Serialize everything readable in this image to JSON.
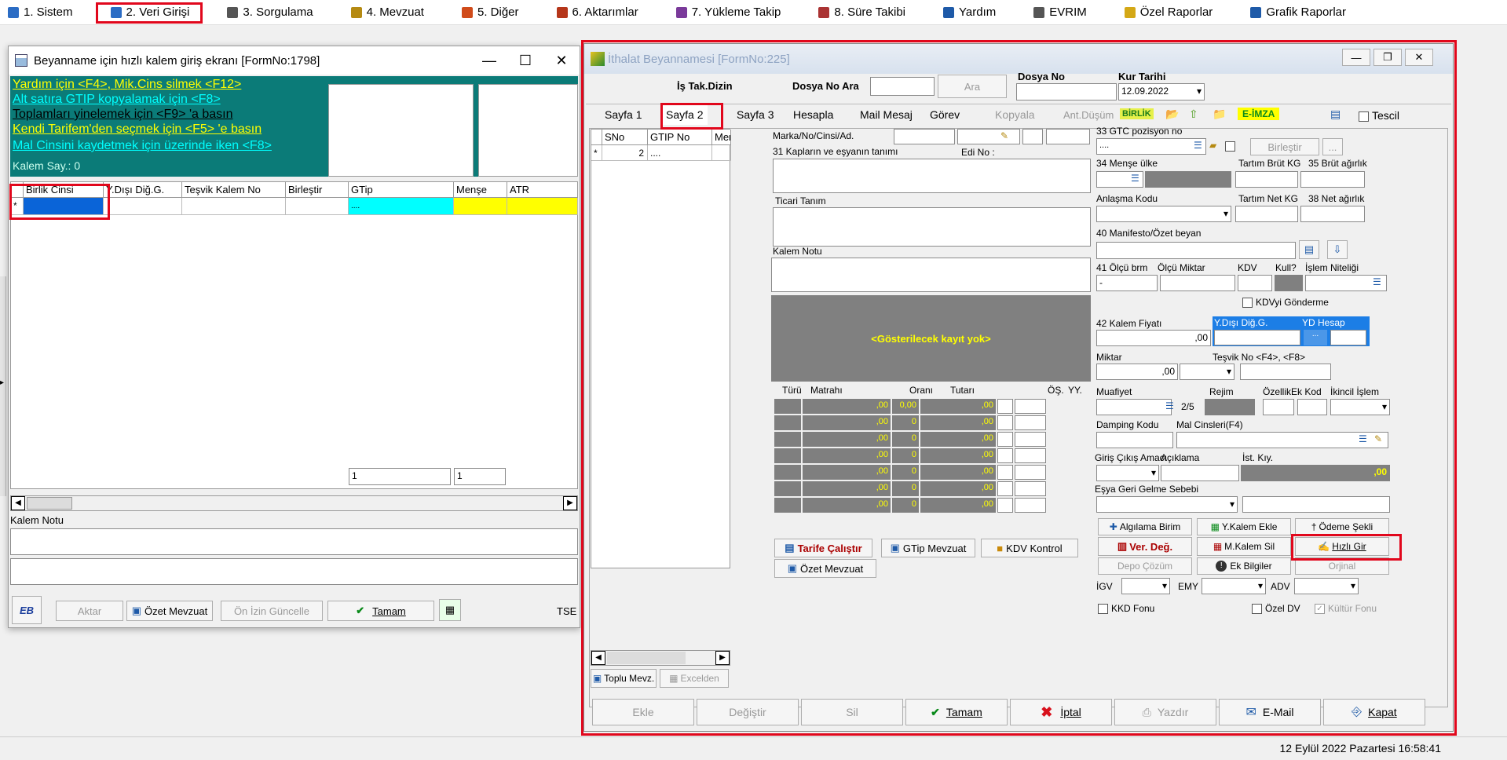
{
  "menu": [
    {
      "num": "1.",
      "label": "Sistem",
      "icon": "system-icon"
    },
    {
      "num": "2.",
      "label": "Veri Girişi",
      "icon": "data-entry-icon"
    },
    {
      "num": "3.",
      "label": "Sorgulama",
      "icon": "query-icon"
    },
    {
      "num": "4.",
      "label": "Mevzuat",
      "icon": "books-icon"
    },
    {
      "num": "5.",
      "label": "Diğer",
      "icon": "other-icon"
    },
    {
      "num": "6.",
      "label": "Aktarımlar",
      "icon": "transfer-icon"
    },
    {
      "num": "7.",
      "label": "Yükleme Takip",
      "icon": "tracking-icon"
    },
    {
      "num": "8.",
      "label": "Süre Takibi",
      "icon": "calendar-icon"
    },
    {
      "num": "",
      "label": "Yardım",
      "icon": "help-icon"
    },
    {
      "num": "",
      "label": "EVRIM",
      "icon": "evrim-icon"
    },
    {
      "num": "",
      "label": "Özel Raporlar",
      "icon": "star-icon"
    },
    {
      "num": "",
      "label": "Grafik Raporlar",
      "icon": "chart-icon"
    }
  ],
  "status": {
    "datetime": "12 Eylül 2022 Pazartesi 16:58:41"
  },
  "quick": {
    "title": "Beyanname için hızlı kalem giriş ekranı [FormNo:1798]",
    "help": [
      {
        "text": "Yardım için <F4>, Mik.Cins silmek <F12>",
        "color": "#ffff00"
      },
      {
        "text": "Alt satıra GTIP kopyalamak için <F8>",
        "color": "#00ffff"
      },
      {
        "text": "Toplamları yinelemek için <F9> 'a basın",
        "color": "#000000"
      },
      {
        "text": "Kendi Tarifem'den seçmek  için <F5> 'e basın",
        "color": "#ffff00"
      },
      {
        "text": "Mal Cinsini kaydetmek için üzerinde iken <F8>",
        "color": "#00ffff"
      }
    ],
    "kalem_say": "Kalem Say.: 0",
    "columns": [
      "Birlik Cinsi",
      "Y.Dışı Diğ.G.",
      "Teşvik Kalem No",
      "Birleştir",
      "GTip",
      "Menşe",
      "ATR"
    ],
    "row_marker": "*",
    "gtip_value": "....",
    "footer_nums": [
      "1",
      "1"
    ],
    "kalem_notu_label": "Kalem Notu",
    "buttons": {
      "aktar": "Aktar",
      "ozet": "Özet Mevzuat",
      "on_izin": "Ön İzin Güncelle",
      "tamam": "Tamam"
    },
    "tse": "TSE"
  },
  "ithal": {
    "title": "İthalat Beyannamesi [FormNo:225]",
    "is_tak": "İş Tak.Dizin",
    "dosya_no_ara": "Dosya No Ara",
    "ara_btn": "Ara",
    "dosya_no": "Dosya No",
    "kur_tarihi": "Kur Tarihi",
    "kur_value": "12.09.2022",
    "tabs": [
      "Sayfa 1",
      "Sayfa 2",
      "Sayfa 3",
      "Hesapla",
      "Mail Mesaj",
      "Görev",
      "Kopyala",
      "Ant.Düşüm"
    ],
    "birlik": "BİRLİK",
    "eimza": "E-İMZA",
    "tescil": "Tescil",
    "list_cols": [
      "SNo",
      "GTIP No",
      "Menşe"
    ],
    "list_row": {
      "marker": "*",
      "sno": "2",
      "gtip": "...."
    },
    "marka": "Marka/No/Cinsi/Ad.",
    "kaplar": "31 Kapların ve eşyanın tanımı",
    "edi": "Edi No :",
    "ticari": "Ticari Tanım",
    "kalem_notu": "Kalem Notu",
    "no_records": "<Gösterilecek kayıt yok>",
    "tax_cols": [
      "Türü",
      "Matrahı",
      "Oranı",
      "Tutarı",
      "ÖŞ.",
      "YY."
    ],
    "tax_rows": [
      [
        ",00",
        "0,00",
        ",00"
      ],
      [
        ",00",
        "0",
        ",00"
      ],
      [
        ",00",
        "0",
        ",00"
      ],
      [
        ",00",
        "0",
        ",00"
      ],
      [
        ",00",
        "0",
        ",00"
      ],
      [
        ",00",
        "0",
        ",00"
      ],
      [
        ",00",
        "0",
        ",00"
      ]
    ],
    "tarife": "Tarife Çalıştır",
    "gtip_mevzuat": "GTip Mevzuat",
    "kdv_kontrol": "KDV Kontrol",
    "ozet_mevzuat": "Özet Mevzuat",
    "toplu": "Toplu Mevz.",
    "excelden": "Excelden",
    "gtc": "33 GTC pozisyon no",
    "gtc_value": "....",
    "birlestir": "Birleştir",
    "mense_ulke": "34 Menşe ülke",
    "tartim_brut": "Tartım Brüt KG",
    "brut": "35 Brüt ağırlık",
    "anlasma": "Anlaşma Kodu",
    "tartim_net": "Tartım Net KG",
    "net": "38 Net ağırlık",
    "manifesto": "40 Manifesto/Özet beyan",
    "olcu_brm": "41 Ölçü brm",
    "olcu_miktar": "Ölçü Miktar",
    "kdv": "KDV",
    "kull": "Kull?",
    "islem": "İşlem Niteliği",
    "olcu_value": "-",
    "kdv_gonderme": "KDVyi Gönderme",
    "kalem_fiyati": "42 Kalem Fiyatı",
    "kalem_fiyati_value": ",00",
    "ydisi": "Y.Dışı Diğ.G.",
    "yd_hesap": "YD Hesap",
    "miktar": "Miktar",
    "miktar_value": ",00",
    "tesvik": "Teşvik No <F4>, <F8>",
    "muafiyet": "Muafiyet",
    "muafiyet_value": "2/5",
    "rejim": "Rejim",
    "ozellik": "ÖzellikEk Kod",
    "ikincil": "İkincil İşlem",
    "damping": "Damping Kodu",
    "mal_cinsleri": "Mal Cinsleri(F4)",
    "giris_cikis": "Giriş Çıkış Amacı",
    "aciklama": "Açıklama",
    "ist_kiy": "İst. Kıy.",
    "ist_value": ",00",
    "esya_geri": "Eşya Geri Gelme Sebebi",
    "algilama": "Algılama Birim",
    "y_kalem": "Y.Kalem Ekle",
    "odeme": "Ödeme Şekli",
    "ver_deg": "Ver. Değ.",
    "m_kalem": "M.Kalem Sil",
    "hizli": "Hızlı Gir",
    "depo": "Depo Çözüm",
    "ek_bilgiler": "Ek Bilgiler",
    "orjinal": "Orjinal",
    "igv": "İGV",
    "emy": "EMY",
    "adv": "ADV",
    "kkd": "KKD Fonu",
    "ozel_dv": "Özel DV",
    "kultur": "Kültür Fonu",
    "bottom": [
      "Ekle",
      "Değiştir",
      "Sil",
      "Tamam",
      "İptal",
      "Yazdır",
      "E-Mail",
      "Kapat"
    ]
  }
}
